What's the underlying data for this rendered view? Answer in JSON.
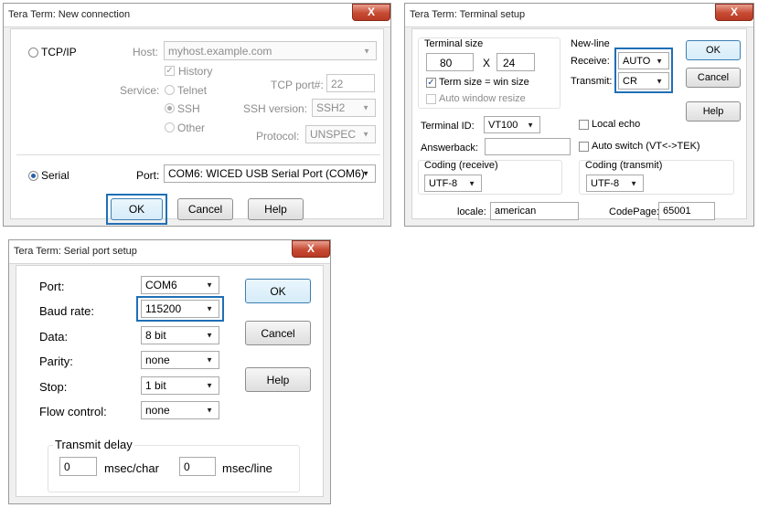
{
  "new_connection": {
    "title": "Tera Term: New connection",
    "close_label": "X",
    "tcpip_label": "TCP/IP",
    "host_label": "Host:",
    "host_value": "myhost.example.com",
    "history_label": "History",
    "tcp_port_label": "TCP port#:",
    "tcp_port_value": "22",
    "service_label": "Service:",
    "telnet_label": "Telnet",
    "ssh_label": "SSH",
    "ssh_version_label": "SSH version:",
    "ssh_version_value": "SSH2",
    "other_label": "Other",
    "protocol_label": "Protocol:",
    "protocol_value": "UNSPEC",
    "serial_label": "Serial",
    "port_label": "Port:",
    "port_value": "COM6: WICED USB Serial Port (COM6)",
    "ok_label": "OK",
    "cancel_label": "Cancel",
    "help_label": "Help"
  },
  "terminal_setup": {
    "title": "Tera Term: Terminal setup",
    "close_label": "X",
    "terminal_size_label": "Terminal size",
    "width_value": "80",
    "times_label": "X",
    "height_value": "24",
    "term_size_label": "Term size = win size",
    "auto_window_label": "Auto window resize",
    "newline_label": "New-line",
    "receive_label": "Receive:",
    "receive_value": "AUTO",
    "transmit_label": "Transmit:",
    "transmit_value": "CR",
    "ok_label": "OK",
    "cancel_label": "Cancel",
    "help_label": "Help",
    "terminal_id_label": "Terminal ID:",
    "terminal_id_value": "VT100",
    "local_echo_label": "Local echo",
    "answerback_label": "Answerback:",
    "answerback_value": "",
    "auto_switch_label": "Auto switch (VT<->TEK)",
    "coding_receive_label": "Coding (receive)",
    "coding_receive_value": "UTF-8",
    "coding_transmit_label": "Coding (transmit)",
    "coding_transmit_value": "UTF-8",
    "locale_label": "locale:",
    "locale_value": "american",
    "codepage_label": "CodePage:",
    "codepage_value": "65001"
  },
  "serial_setup": {
    "title": "Tera Term: Serial port setup",
    "close_label": "X",
    "port_label": "Port:",
    "port_value": "COM6",
    "baud_label": "Baud rate:",
    "baud_value": "115200",
    "data_label": "Data:",
    "data_value": "8 bit",
    "parity_label": "Parity:",
    "parity_value": "none",
    "stop_label": "Stop:",
    "stop_value": "1 bit",
    "flow_label": "Flow control:",
    "flow_value": "none",
    "ok_label": "OK",
    "cancel_label": "Cancel",
    "help_label": "Help",
    "transmit_delay_label": "Transmit delay",
    "char_delay_value": "0",
    "char_unit_label": "msec/char",
    "line_delay_value": "0",
    "line_unit_label": "msec/line"
  },
  "colors": {
    "highlight": "#1f6fb5",
    "close_button": "#c74a33"
  }
}
